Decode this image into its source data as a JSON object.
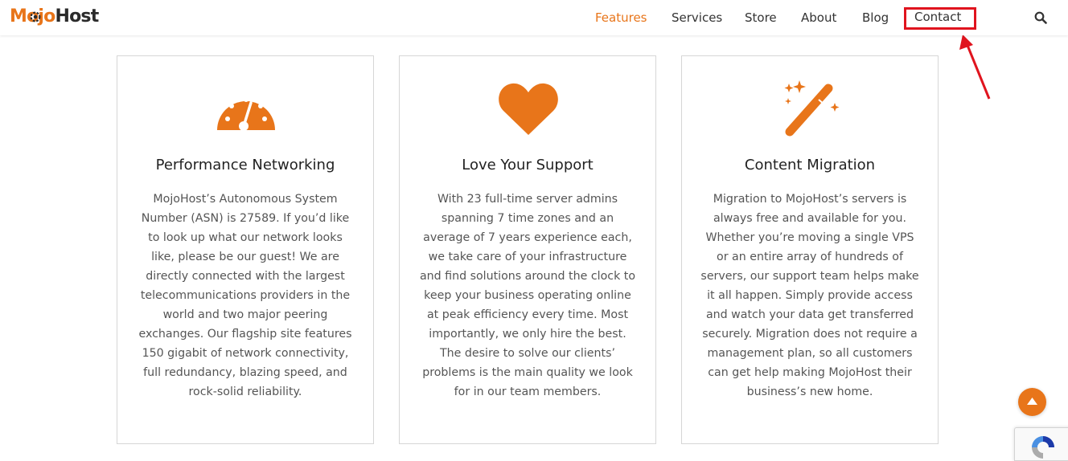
{
  "brand": {
    "logo_part1": "Mojo",
    "logo_part2": "Host",
    "accent_color": "#e8751a"
  },
  "nav": {
    "items": [
      {
        "label": "Features",
        "active": true
      },
      {
        "label": "Services",
        "active": false
      },
      {
        "label": "Store",
        "active": false
      },
      {
        "label": "About",
        "active": false
      },
      {
        "label": "Blog",
        "active": false
      },
      {
        "label": "Contact",
        "active": false,
        "highlighted": true
      }
    ],
    "search_icon": "search-icon"
  },
  "features": [
    {
      "icon": "speedometer-icon",
      "title": "Performance Networking",
      "body": "MojoHost’s Autonomous System Number (ASN) is 27589. If you’d like to look up what our network looks like, please be our guest! We are directly connected with the largest telecommunications providers in the world and two major peering exchanges. Our flagship site features 150 gigabit of network connectivity, full redundancy, blazing speed, and rock-solid reliability."
    },
    {
      "icon": "heart-icon",
      "title": "Love Your Support",
      "body": "With 23 full-time server admins spanning 7 time zones and an average of 7 years experience each, we take care of your infrastructure and find solutions around the clock to keep your business operating online at peak efficiency every time. Most importantly, we only hire the best. The desire to solve our clients’ problems is the main quality we look for in our team members."
    },
    {
      "icon": "magic-wand-icon",
      "title": "Content Migration",
      "body": "Migration to MojoHost’s servers is always free and available for you. Whether you’re moving a single VPS or an entire array of hundreds of servers, our support team helps make it all happen. Simply provide access and watch your data get transferred securely. Migration does not require a management plan, so all customers can get help making MojoHost their business’s new home."
    }
  ],
  "annotation": {
    "highlight_color": "#e0141e"
  },
  "scroll_top_icon": "chevron-up-icon",
  "recaptcha_icon": "recaptcha-icon"
}
